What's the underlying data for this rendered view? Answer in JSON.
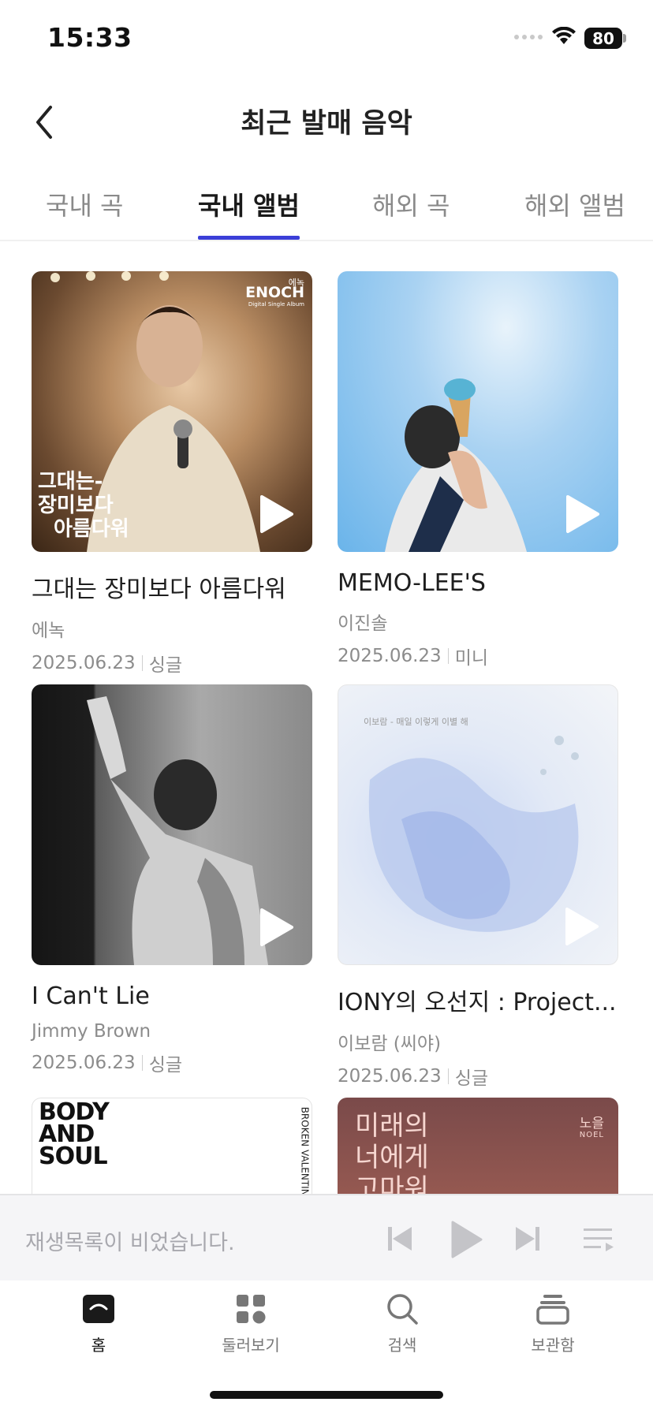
{
  "status_bar": {
    "time": "15:33",
    "battery": "80"
  },
  "header": {
    "title": "최근 발매 음악"
  },
  "tabs": [
    {
      "label": "국내 곡"
    },
    {
      "label": "국내 앨범"
    },
    {
      "label": "해외 곡"
    },
    {
      "label": "해외 앨범"
    }
  ],
  "active_tab": "국내 앨범",
  "albums": [
    {
      "title": "그대는 장미보다 아름다워",
      "artist": "에녹",
      "date": "2025.06.23",
      "type": "싱글",
      "cover_text": {
        "logo": "ENOCH",
        "logo_sub_ko": "에녹",
        "subtitle": "Digital Single Album",
        "lines": [
          "그대는-",
          "장미보다",
          "아름다워"
        ]
      }
    },
    {
      "title": "MEMO-LEE'S",
      "artist": "이진솔",
      "date": "2025.06.23",
      "type": "미니"
    },
    {
      "title": "I Can't Lie",
      "artist": "Jimmy Brown",
      "date": "2025.06.23",
      "type": "싱글"
    },
    {
      "title": "IONY의 오선지 : Project...",
      "artist": "이보람 (씨야)",
      "date": "2025.06.23",
      "type": "싱글",
      "cover_text": {
        "top": "이보람 - 매일 이렇게 이별 해"
      }
    },
    {
      "title": "",
      "artist": "",
      "date": "",
      "type": "",
      "cover_text": {
        "lines": [
          "BODY",
          "AND",
          "SOUL"
        ],
        "side": "BROKEN VALENTINE"
      }
    },
    {
      "title": "",
      "artist": "",
      "date": "",
      "type": "",
      "cover_text": {
        "lines": [
          "미래의",
          "너에게",
          "고마워"
        ],
        "artist_ko": "노을",
        "artist_en": "NOEL"
      }
    }
  ],
  "player": {
    "empty_text": "재생목록이 비었습니다."
  },
  "nav": [
    {
      "label": "홈",
      "icon": "home-icon"
    },
    {
      "label": "둘러보기",
      "icon": "browse-grid-icon"
    },
    {
      "label": "검색",
      "icon": "search-icon"
    },
    {
      "label": "보관함",
      "icon": "library-icon"
    }
  ],
  "colors": {
    "accent": "#3b3fd8",
    "text_primary": "#1e1e1e",
    "text_secondary": "#8c8c8c"
  }
}
